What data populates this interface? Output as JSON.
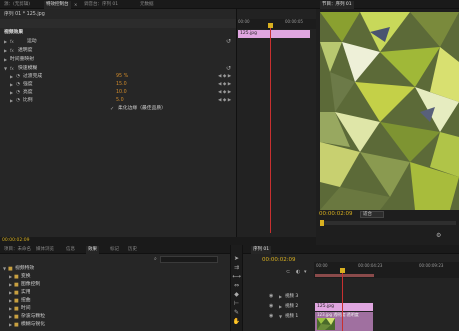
{
  "top_tabs": [
    {
      "label": "源：(无剪辑)"
    },
    {
      "label": "特效控制台"
    },
    {
      "label": "调音台：序列 01"
    },
    {
      "label": "元数据"
    }
  ],
  "program_tab": {
    "label": "节目：序列 01"
  },
  "fx_header": {
    "sequence": "序列 01 * 125.jpg",
    "clip_label": "125.jpg"
  },
  "fx_rows": [
    {
      "label": "视频效果"
    },
    {
      "label": "运动"
    },
    {
      "label": "透明度"
    },
    {
      "label": "时间重映射"
    },
    {
      "label": "快速模糊"
    }
  ],
  "fx_params": [
    {
      "label": "过渡完成",
      "value": "95 %"
    },
    {
      "label": "强度",
      "value": "15.0"
    },
    {
      "label": "亮度",
      "value": "10.0"
    },
    {
      "label": "比例",
      "value": "5.0"
    }
  ],
  "fx_checkbox": {
    "label": "柔化边缘（最佳品质）"
  },
  "fx_footer": {
    "timecode": "00:00:02:09"
  },
  "ruler_fx": {
    "labels": [
      "00:00",
      "00:00:05"
    ]
  },
  "program": {
    "timecode": "00:00:02:09",
    "fit": "适合"
  },
  "project_tabs": [
    {
      "label": "项目：未命名"
    },
    {
      "label": "媒体浏览"
    },
    {
      "label": "信息"
    },
    {
      "label": "效果"
    },
    {
      "label": "标记"
    },
    {
      "label": "历史"
    }
  ],
  "effects_tree": [
    {
      "label": "视频特效"
    },
    {
      "label": "变换"
    },
    {
      "label": "图像控制"
    },
    {
      "label": "实用"
    },
    {
      "label": "扭曲"
    },
    {
      "label": "时间"
    },
    {
      "label": "杂波与颗粒"
    },
    {
      "label": "模糊与锐化"
    }
  ],
  "timeline": {
    "tab": "序列 01",
    "timecode": "00:00:02:09",
    "ruler": [
      "00:00",
      "00:00:04:23",
      "00:00:09:23"
    ],
    "tracks": [
      {
        "label": "视频 3"
      },
      {
        "label": "视频 2"
      },
      {
        "label": "视频 1"
      }
    ],
    "clip_v2": "125.jpg",
    "clip_v1": "123.jpg 透明度:透明度"
  },
  "colors": {
    "accent": "#e0a6e0",
    "playhead": "#c83030",
    "value": "#d08a2a",
    "timecode": "#d8b020"
  }
}
